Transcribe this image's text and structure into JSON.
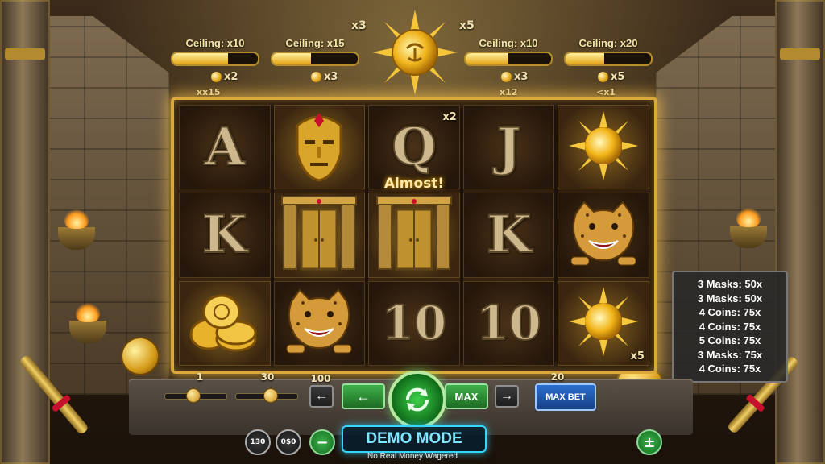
{
  "ceilings": [
    {
      "label": "Ceiling: x10",
      "fill": 0.65,
      "coin_mult": "x2",
      "small": "xx15"
    },
    {
      "label": "Ceiling: x15",
      "fill": 0.45,
      "coin_mult": "x3",
      "small": ""
    },
    {
      "label": "Ceiling: x10",
      "fill": 0.5,
      "coin_mult": "x3",
      "small": "x12"
    },
    {
      "label": "Ceiling: x20",
      "fill": 0.45,
      "coin_mult": "x5",
      "small": "<x1"
    }
  ],
  "sun": {
    "left_mult": "x3",
    "right_mult": "x5"
  },
  "reels": [
    [
      {
        "symbol": "A",
        "kind": "letter"
      },
      {
        "symbol": "K",
        "kind": "letter"
      },
      {
        "symbol": "coins-icon",
        "kind": "icon",
        "highlight": true
      }
    ],
    [
      {
        "symbol": "mask-icon",
        "kind": "icon",
        "highlight": true
      },
      {
        "symbol": "door-icon",
        "kind": "icon",
        "highlight": true
      },
      {
        "symbol": "jaguar-icon",
        "kind": "icon"
      }
    ],
    [
      {
        "symbol": "Q",
        "kind": "letter",
        "badge": "x2"
      },
      {
        "symbol": "door-icon",
        "kind": "icon",
        "highlight": true
      },
      {
        "symbol": "10",
        "kind": "num"
      }
    ],
    [
      {
        "symbol": "J",
        "kind": "letter"
      },
      {
        "symbol": "K",
        "kind": "letter"
      },
      {
        "symbol": "10",
        "kind": "num"
      }
    ],
    [
      {
        "symbol": "sun-icon",
        "kind": "icon",
        "highlight": true
      },
      {
        "symbol": "jaguar-icon",
        "kind": "icon"
      },
      {
        "symbol": "sun-icon",
        "kind": "icon",
        "highlight": true,
        "badge": "x5"
      }
    ]
  ],
  "almost_text": "Almost!",
  "paytable": [
    "3 Masks: 50x",
    "3 Masks: 50x",
    "4 Coins: 75x",
    "4 Coins: 75x",
    "5 Coins: 75x",
    "3 Masks: 75x",
    "4 Coins: 75x"
  ],
  "controls": {
    "slider1_value": "1",
    "slider1_level": 0.45,
    "slider2_value": "30",
    "slider2_level": 0.55,
    "bet_value": "100",
    "arrow_left": "←",
    "arrow_right": "→",
    "green_left": "←",
    "max_label": "MAX",
    "max_bet_value": "20",
    "max_bet_label": "MAX BET",
    "round1_top": "1",
    "round1_bottom": "30",
    "round2_top": "0",
    "round2_bottom": "$0",
    "minus_label": "−",
    "plus_label": "±",
    "demo_label": "DEMO MODE",
    "demo_sub": "No Real Money Wagered"
  },
  "colors": {
    "gold": "#d9a93a",
    "spin_green": "#3ed04a",
    "demo_cyan": "#34d6ff",
    "max_bet_blue": "#2b6fd0"
  }
}
